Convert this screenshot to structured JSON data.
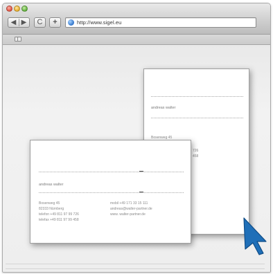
{
  "browser": {
    "url": "http://www.sigel.eu",
    "nav": {
      "back_glyph": "◀",
      "forward_glyph": "▶",
      "reload_glyph": "C",
      "add_glyph": "+"
    }
  },
  "icons": [
    "back-icon",
    "forward-icon",
    "reload-icon",
    "add-tab-icon",
    "globe-icon",
    "bookmarks-icon",
    "mouse-pointer-icon"
  ],
  "colors": {
    "cursor": "#1f6fb8",
    "page_bg": "#eeeeee",
    "card": "#ffffff"
  },
  "card_back": {
    "name": "andreas walter",
    "address_lines": [
      "Bosenweg 45"
    ],
    "partial_lines": [
      "726",
      "458"
    ]
  },
  "card_front": {
    "name": "andreas walter",
    "left_lines": [
      "Bosenweg 45",
      "82333 Nürnberg",
      "telefon +49 811 97 99 726",
      "telefax +49 811 97 99 458"
    ],
    "right_lines": [
      "mobil +49 171 33 15 111",
      "andreas@walter-partner.de",
      "www. walter-partner.de"
    ]
  }
}
